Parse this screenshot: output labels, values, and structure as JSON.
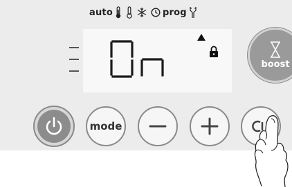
{
  "status_row": {
    "auto_label": "auto",
    "prog_label": "prog",
    "icons": [
      "thermometer-comfort-icon",
      "thermometer-eco-icon",
      "frost-protection-icon",
      "clock-icon",
      "program-icon"
    ]
  },
  "display": {
    "main_text": "On",
    "indicators": [
      "arrow-up-icon",
      "padlock-icon"
    ],
    "level_marks": 3
  },
  "buttons": {
    "power": "power-icon",
    "mode_label": "mode",
    "minus": "minus-icon",
    "plus": "plus-icon",
    "favourite": "favourite-icon",
    "boost_label": "boost",
    "boost_icon": "hourglass-icon"
  },
  "colors": {
    "panel": "#ececec",
    "lcd": "#f8f8f8",
    "button_grey": "#8c8c8c",
    "boost_grey": "#9a9a9a"
  }
}
